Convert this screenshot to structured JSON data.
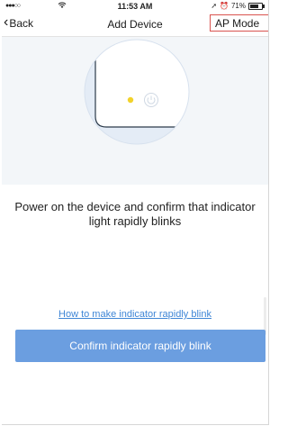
{
  "status_bar": {
    "signal": "●●●○○",
    "time": "11:53 AM",
    "battery": "71%",
    "battery_level": 0.71
  },
  "nav": {
    "back_label": "Back",
    "title": "Add Device",
    "ap_mode_label": "AP Mode"
  },
  "instruction": "Power on the device and confirm that indicator light rapidly blinks",
  "help_link": "How to make indicator rapidly blink",
  "confirm_button": "Confirm indicator rapidly blink",
  "colors": {
    "accent": "#6b9ee0",
    "link": "#3f86d6",
    "indicator_light": "#f2d22a",
    "highlight_border": "#d9534f"
  }
}
